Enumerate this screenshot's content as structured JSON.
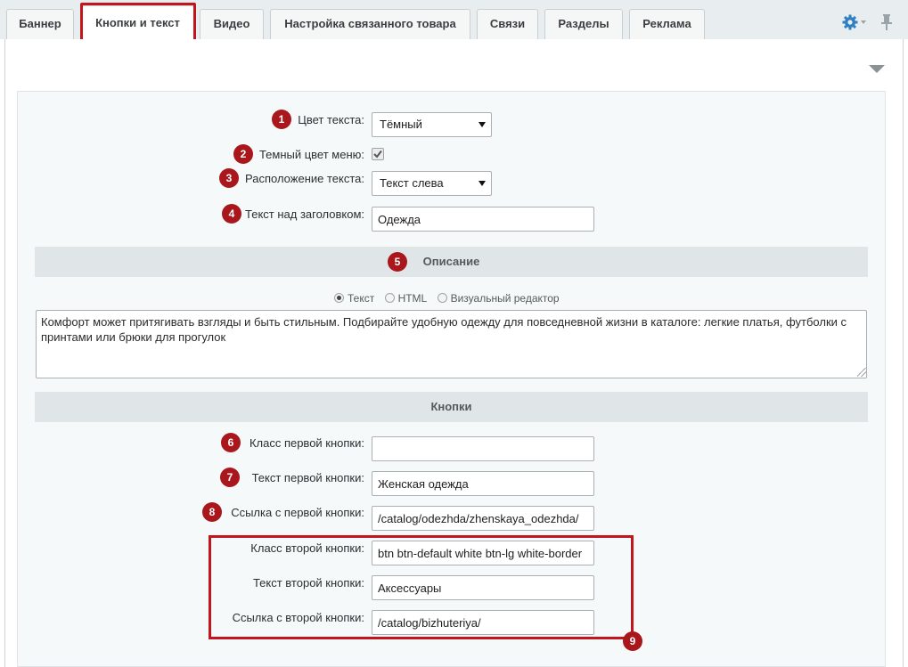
{
  "tabs": [
    {
      "label": "Баннер"
    },
    {
      "label": "Кнопки и текст",
      "active": true
    },
    {
      "label": "Видео"
    },
    {
      "label": "Настройка связанного товара"
    },
    {
      "label": "Связи"
    },
    {
      "label": "Разделы"
    },
    {
      "label": "Реклама"
    }
  ],
  "icons": {
    "settings": "gear-icon",
    "pin": "pin-icon",
    "collapse": "triangle-down-icon"
  },
  "colors": {
    "accent_red": "#a9171c",
    "gear_blue": "#2f7fc1",
    "section_bg": "#e0e6e7"
  },
  "form": {
    "text_color": {
      "badge": "1",
      "label": "Цвет текста:",
      "value": "Тёмный"
    },
    "dark_menu": {
      "badge": "2",
      "label": "Темный цвет меню:",
      "checked": true
    },
    "text_position": {
      "badge": "3",
      "label": "Расположение текста:",
      "value": "Текст слева"
    },
    "text_above_title": {
      "badge": "4",
      "label": "Текст над заголовком:",
      "value": "Одежда"
    }
  },
  "description": {
    "badge": "5",
    "heading": "Описание",
    "modes": [
      "Текст",
      "HTML",
      "Визуальный редактор"
    ],
    "selected_mode": "Текст",
    "text": "Комфорт может притягивать взгляды и быть стильным. Подбирайте удобную одежду для повседневной жизни в каталоге: легкие платья, футболки с принтами или брюки для прогулок"
  },
  "buttons": {
    "heading": "Кнопки",
    "first_class": {
      "badge": "6",
      "label": "Класс первой кнопки:",
      "value": ""
    },
    "first_text": {
      "badge": "7",
      "label": "Текст первой кнопки:",
      "value": "Женская одежда"
    },
    "first_link": {
      "badge": "8",
      "label": "Ссылка с первой кнопки:",
      "value": "/catalog/odezhda/zhenskaya_odezhda/"
    },
    "second_class": {
      "label": "Класс второй кнопки:",
      "value": "btn btn-default white btn-lg white-border"
    },
    "second_text": {
      "label": "Текст второй кнопки:",
      "value": "Аксессуары"
    },
    "second_link": {
      "label": "Ссылка с второй кнопки:",
      "value": "/catalog/bizhuteriya/"
    },
    "group_badge": "9"
  }
}
